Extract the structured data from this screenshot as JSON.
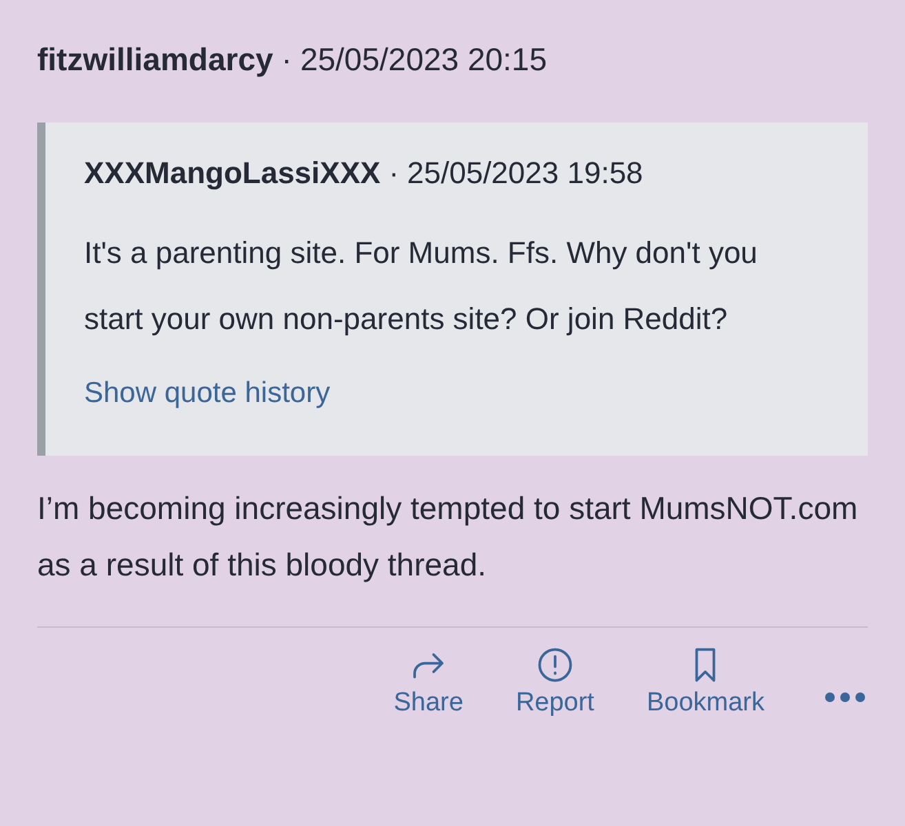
{
  "post": {
    "author": "fitzwilliamdarcy",
    "separator": "·",
    "timestamp": "25/05/2023 20:15"
  },
  "quote": {
    "author": "XXXMangoLassiXXX",
    "separator": "·",
    "timestamp": "25/05/2023 19:58",
    "text": "It's a parenting site. For Mums. Ffs. Why don't you start your own non-parents site? Or join Reddit?",
    "link": "Show quote history"
  },
  "body": "I’m becoming increasingly tempted to start MumsNOT.com as a result of this bloody thread.",
  "actions": [
    {
      "kind": "share",
      "label": "Share"
    },
    {
      "kind": "report",
      "label": "Report"
    },
    {
      "kind": "bookmark",
      "label": "Bookmark"
    },
    {
      "kind": "more"
    }
  ]
}
